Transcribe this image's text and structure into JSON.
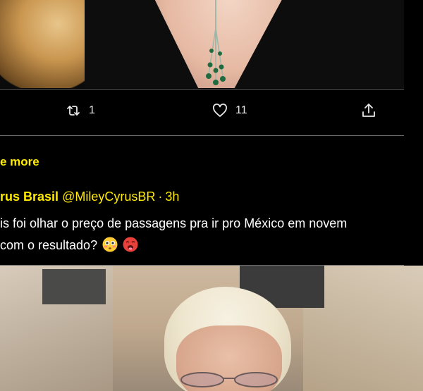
{
  "tweet_actions": {
    "retweet_count": "1",
    "like_count": "11"
  },
  "thread": {
    "show_more_label": "e more"
  },
  "quoted_tweet": {
    "display_name": "rus Brasil",
    "handle": "@MileyCyrusBR",
    "separator": "·",
    "time": "3h",
    "text_line1": "is foi olhar o preço de passagens pra ir pro México em novem",
    "text_line2": "com o resultado?"
  },
  "colors": {
    "accent": "#ffea00",
    "background": "#000000",
    "border": "#6e6e6e",
    "text": "#ffffff"
  },
  "icons": {
    "retweet": "retweet-icon",
    "like": "heart-icon",
    "share": "share-icon",
    "emoji1": "flushed-face-emoji",
    "emoji2": "hot-face-emoji"
  }
}
